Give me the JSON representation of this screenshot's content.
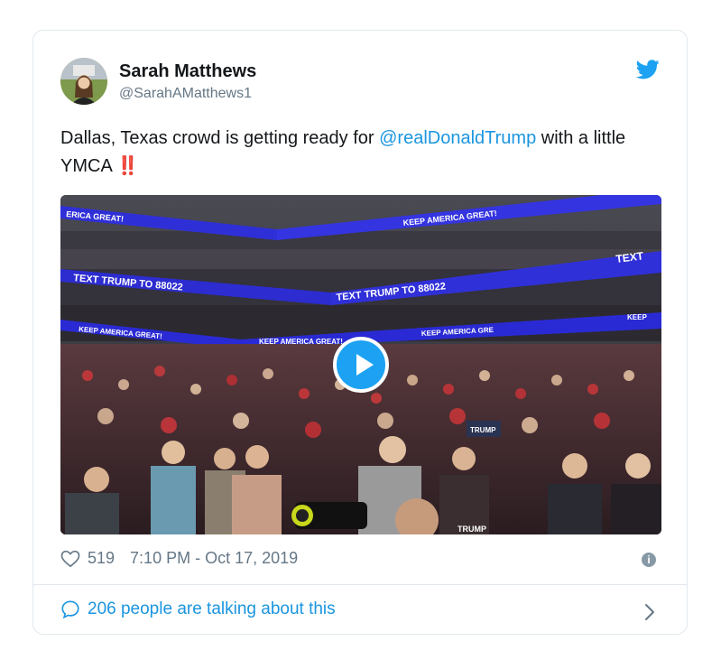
{
  "tweet": {
    "author_name": "Sarah Matthews",
    "author_handle": "@SarahAMatthews1",
    "text_before": "Dallas, Texas crowd is getting ready for ",
    "mention": "@realDonaldTrump",
    "text_after": " with a little YMCA ",
    "emoji": "‼️",
    "likes": "519",
    "timestamp": "7:10 PM - Oct 17, 2019",
    "talking": "206 people are talking about this"
  },
  "video": {
    "banners": {
      "top_left": "ERICA GREAT!",
      "top_right": "KEEP AMERICA GREAT!",
      "middle_left": "TEXT TRUMP TO 88022",
      "middle_center": "TEXT TRUMP TO 88022",
      "middle_right": "TEXT",
      "bottom_1": "KEEP AMERICA GREAT!",
      "bottom_2": "KEEP AMERICA GREAT!",
      "bottom_3": "KEEP AMERICA GRE",
      "bottom_4": "KEEP"
    },
    "sign_text": "TRUMP",
    "sign_text_2": "TRUMP"
  },
  "icons": {
    "bird": "twitter-bird-icon",
    "heart": "heart-icon",
    "info": "info-icon",
    "bubble": "speech-bubble-icon",
    "chevron": "chevron-right-icon",
    "play": "play-icon"
  },
  "colors": {
    "twitter_blue": "#1da1f2",
    "link_blue": "#1b95e0",
    "banner_blue": "#2f2fd8",
    "muted": "#657786"
  }
}
